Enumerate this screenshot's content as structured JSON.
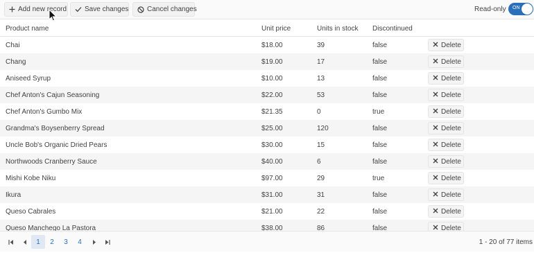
{
  "toolbar": {
    "add_label": "Add new record",
    "save_label": "Save changes",
    "cancel_label": "Cancel changes",
    "readonly_label": "Read-only",
    "switch_label": "ON"
  },
  "columns": [
    "Product name",
    "Unit price",
    "Units in stock",
    "Discontinued"
  ],
  "rows": [
    {
      "name": "Chai",
      "price": "$18.00",
      "stock": "39",
      "disc": "false"
    },
    {
      "name": "Chang",
      "price": "$19.00",
      "stock": "17",
      "disc": "false"
    },
    {
      "name": "Aniseed Syrup",
      "price": "$10.00",
      "stock": "13",
      "disc": "false"
    },
    {
      "name": "Chef Anton's Cajun Seasoning",
      "price": "$22.00",
      "stock": "53",
      "disc": "false"
    },
    {
      "name": "Chef Anton's Gumbo Mix",
      "price": "$21.35",
      "stock": "0",
      "disc": "true"
    },
    {
      "name": "Grandma's Boysenberry Spread",
      "price": "$25.00",
      "stock": "120",
      "disc": "false"
    },
    {
      "name": "Uncle Bob's Organic Dried Pears",
      "price": "$30.00",
      "stock": "15",
      "disc": "false"
    },
    {
      "name": "Northwoods Cranberry Sauce",
      "price": "$40.00",
      "stock": "6",
      "disc": "false"
    },
    {
      "name": "Mishi Kobe Niku",
      "price": "$97.00",
      "stock": "29",
      "disc": "true"
    },
    {
      "name": "Ikura",
      "price": "$31.00",
      "stock": "31",
      "disc": "false"
    },
    {
      "name": "Queso Cabrales",
      "price": "$21.00",
      "stock": "22",
      "disc": "false"
    },
    {
      "name": "Queso Manchego La Pastora",
      "price": "$38.00",
      "stock": "86",
      "disc": "false"
    }
  ],
  "delete_label": "Delete",
  "pager": {
    "pages": [
      "1",
      "2",
      "3",
      "4"
    ],
    "current": "1",
    "info": "1 - 20 of 77 items"
  },
  "colors": {
    "accent": "#2a6fba",
    "row_alt": "#f5f5f5"
  }
}
